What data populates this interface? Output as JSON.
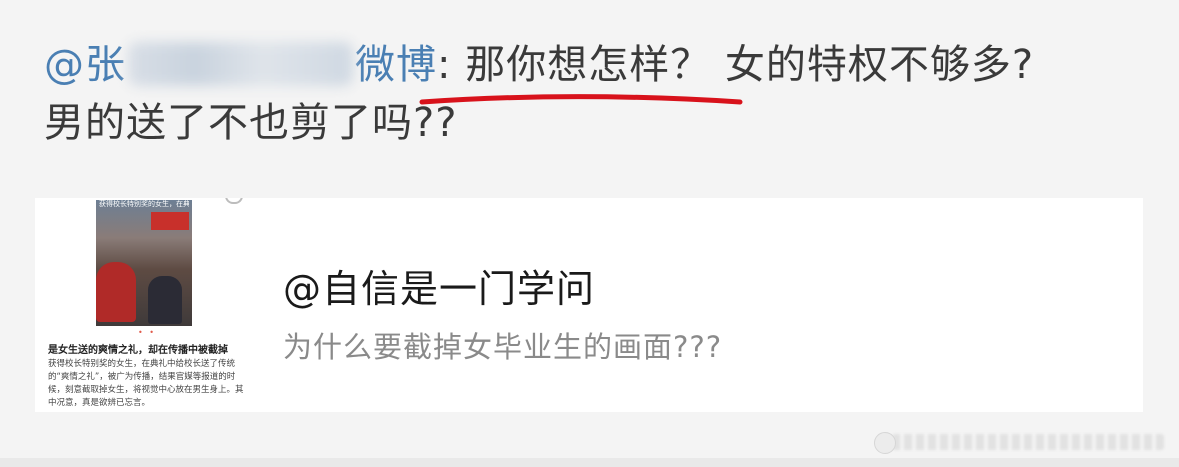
{
  "post": {
    "mention_prefix": "@张",
    "mention_suffix": "微博",
    "separator": ": ",
    "text_line1": "那你想怎样？ 女的特权不够多?",
    "text_line2": "男的送了不也剪了吗??"
  },
  "shared_card": {
    "title": "@自信是一门学问",
    "subtitle": "为什么要截掉女毕业生的画面???",
    "thumbnail": {
      "caption": "获得校长特别奖的女生，在典礼",
      "title": "是女生送的爽情之礼，却在传播中被截掉",
      "body": "获得校长特别奖的女生，在典礼中给校长送了传统的“爽情之礼”，被广为传播，结果官媒等报道的时候，刻意截取掉女生，将视觉中心放在男生身上。其中况意，真是欲辨已忘言。"
    }
  },
  "colors": {
    "mention": "#4a7fb3",
    "text": "#3a3a3a",
    "underline": "#d8121b",
    "background": "#f4f4f4"
  }
}
